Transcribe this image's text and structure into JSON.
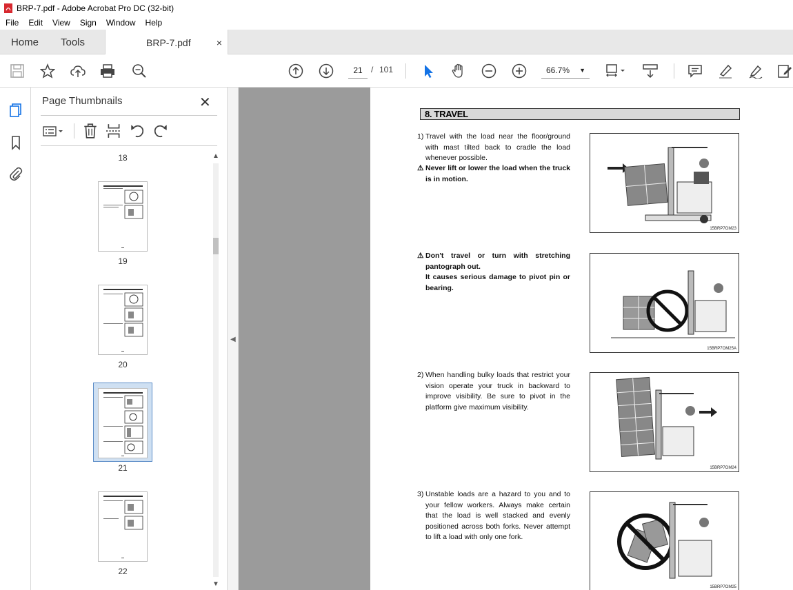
{
  "window": {
    "title": "BRP-7.pdf - Adobe Acrobat Pro DC (32-bit)"
  },
  "menu": [
    "File",
    "Edit",
    "View",
    "Sign",
    "Window",
    "Help"
  ],
  "tabs": {
    "home": "Home",
    "tools": "Tools",
    "document": "BRP-7.pdf",
    "close": "×"
  },
  "toolbar": {
    "current_page": "21",
    "page_separator": "/",
    "total_pages": "101",
    "zoom": "66.7%"
  },
  "panel": {
    "title": "Page Thumbnails",
    "close": "✕",
    "thumbnails": [
      {
        "label": "18"
      },
      {
        "label": "19"
      },
      {
        "label": "20"
      },
      {
        "label": "21",
        "selected": true
      },
      {
        "label": "22"
      }
    ]
  },
  "document": {
    "section_title": "8. TRAVEL",
    "items": [
      {
        "number": "1)",
        "text": "Travel with the load near the floor/ground with mast tilted back to cradle the load whenever possible.",
        "warning": "Never lift or lower the load when the truck is in motion.",
        "figure_code": "15BRP7OM23"
      },
      {
        "warning": "Don't travel or turn with stretching pantograph out.",
        "warning2": "It causes serious damage to pivot pin or bearing.",
        "figure_code": "15BRP7OM25A"
      },
      {
        "number": "2)",
        "text": "When handling bulky loads that restrict your vision operate your truck in backward to improve visibility.  Be sure to pivot in the platform give maximum visibility.",
        "figure_code": "15BRP7OM24"
      },
      {
        "number": "3)",
        "text": "Unstable loads are a hazard to you and to your fellow workers.  Always make certain that the load is well stacked and evenly positioned across both forks.  Never attempt to lift a load with only one fork.",
        "figure_code": "15BRP7OM25"
      }
    ]
  },
  "colors": {
    "accent": "#1473e6",
    "viewer_bg": "#9b9b9b",
    "selected_thumb": "#cfe0f2"
  }
}
